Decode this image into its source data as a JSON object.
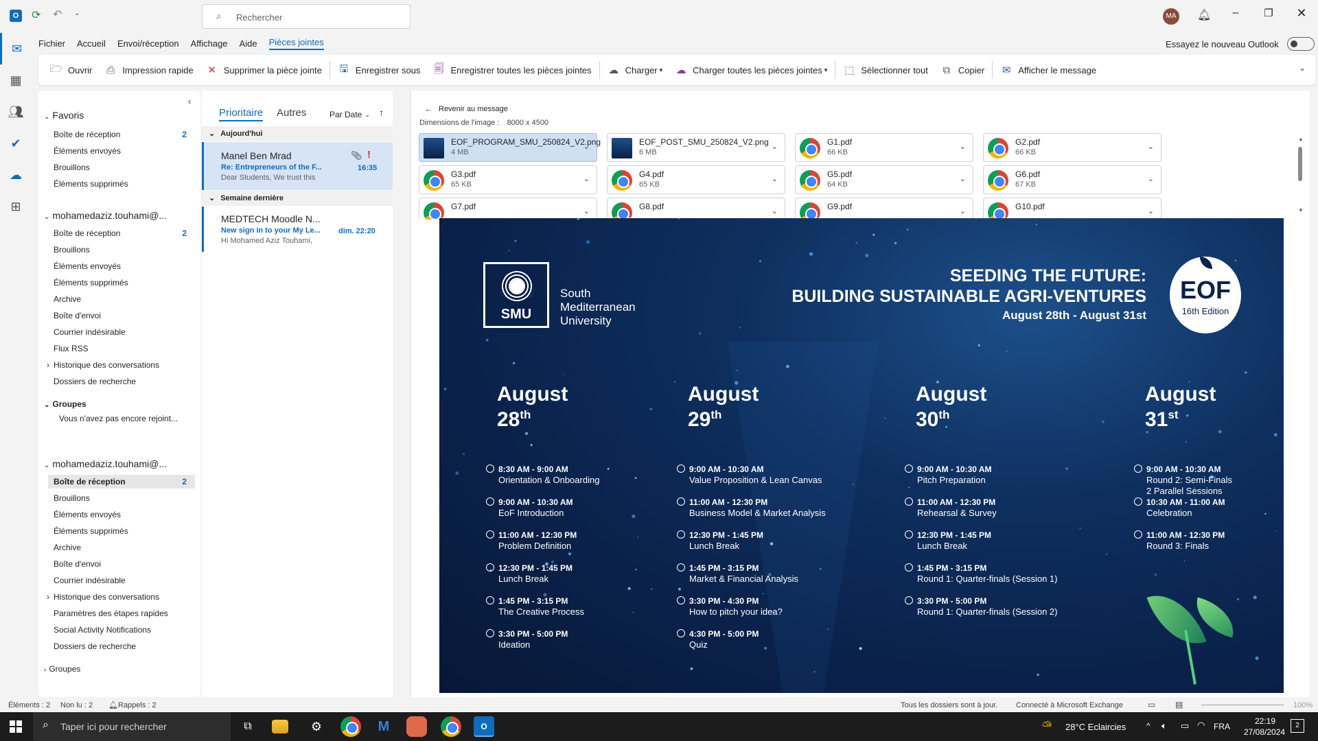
{
  "titlebar": {
    "search_placeholder": "Rechercher",
    "avatar_initials": "MA"
  },
  "menu": [
    "Fichier",
    "Accueil",
    "Envoi/réception",
    "Affichage",
    "Aide",
    "Pièces jointes"
  ],
  "try_new": "Essayez le nouveau Outlook",
  "ribbon": {
    "open": "Ouvrir",
    "quick_print": "Impression rapide",
    "remove_attachment": "Supprimer la pièce jointe",
    "save_as": "Enregistrer sous",
    "save_all": "Enregistrer toutes les pièces jointes",
    "upload": "Charger",
    "upload_all": "Charger toutes les pièces jointes",
    "select_all": "Sélectionner tout",
    "copy": "Copier",
    "show_message": "Afficher le message"
  },
  "folders": {
    "favorites_title": "Favoris",
    "favorites": [
      {
        "label": "Boîte de réception",
        "count": "2"
      },
      {
        "label": "Éléments envoyés",
        "count": ""
      },
      {
        "label": "Brouillons",
        "count": ""
      },
      {
        "label": "Éléments supprimés",
        "count": ""
      }
    ],
    "account1": "mohamedaziz.touhami@...",
    "account1_items": [
      {
        "label": "Boîte de réception",
        "count": "2"
      },
      {
        "label": "Brouillons",
        "count": ""
      },
      {
        "label": "Éléments envoyés",
        "count": ""
      },
      {
        "label": "Éléments supprimés",
        "count": ""
      },
      {
        "label": "Archive",
        "count": ""
      },
      {
        "label": "Boîte d'envoi",
        "count": ""
      },
      {
        "label": "Courrier indésirable",
        "count": ""
      },
      {
        "label": "Flux RSS",
        "count": ""
      },
      {
        "label": "Historique des conversations",
        "count": ""
      },
      {
        "label": "Dossiers de recherche",
        "count": ""
      }
    ],
    "groups_title": "Groupes",
    "groups_note": "Vous n'avez pas encore rejoint...",
    "account2": "mohamedaziz.touhami@...",
    "account2_items": [
      {
        "label": "Boîte de réception",
        "count": "2"
      },
      {
        "label": "Brouillons",
        "count": ""
      },
      {
        "label": "Éléments envoyés",
        "count": ""
      },
      {
        "label": "Éléments supprimés",
        "count": ""
      },
      {
        "label": "Archive",
        "count": ""
      },
      {
        "label": "Boîte d'envoi",
        "count": ""
      },
      {
        "label": "Courrier indésirable",
        "count": ""
      },
      {
        "label": "Historique des conversations",
        "count": ""
      },
      {
        "label": "Paramètres des étapes rapides",
        "count": ""
      },
      {
        "label": "Social Activity Notifications",
        "count": ""
      },
      {
        "label": "Dossiers de recherche",
        "count": ""
      }
    ],
    "groups2_title": "Groupes"
  },
  "maillist": {
    "tab_focused": "Prioritaire",
    "tab_other": "Autres",
    "sort": "Par Date",
    "group_today": "Aujourd'hui",
    "group_lastweek": "Semaine dernière",
    "messages": [
      {
        "sender": "Manel Ben Mrad",
        "subject": "Re: Entrepreneurs of the F...",
        "time": "16:35",
        "preview": "Dear Students,  We trust this"
      },
      {
        "sender": "MEDTECH Moodle N...",
        "subject": "New sign in to your My Le...",
        "time": "dim. 22:20",
        "preview": "Hi Mohamed Aziz Touhami,"
      }
    ]
  },
  "reading": {
    "back": "Revenir au message",
    "dimensions_label": "Dimensions de l'image :",
    "dimensions_value": "8000 x 4500",
    "attachments": [
      {
        "name": "EOF_PROGRAM_SMU_250824_V2.png",
        "size": "4 MB",
        "type": "image"
      },
      {
        "name": "EOF_POST_SMU_250824_V2.png",
        "size": "6 MB",
        "type": "image"
      },
      {
        "name": "G1.pdf",
        "size": "66 KB",
        "type": "pdf"
      },
      {
        "name": "G2.pdf",
        "size": "66 KB",
        "type": "pdf"
      },
      {
        "name": "G3.pdf",
        "size": "65 KB",
        "type": "pdf"
      },
      {
        "name": "G4.pdf",
        "size": "65 KB",
        "type": "pdf"
      },
      {
        "name": "G5.pdf",
        "size": "64 KB",
        "type": "pdf"
      },
      {
        "name": "G6.pdf",
        "size": "67 KB",
        "type": "pdf"
      },
      {
        "name": "G7.pdf",
        "size": "",
        "type": "pdf"
      },
      {
        "name": "G8.pdf",
        "size": "",
        "type": "pdf"
      },
      {
        "name": "G9.pdf",
        "size": "",
        "type": "pdf"
      },
      {
        "name": "G10.pdf",
        "size": "",
        "type": "pdf"
      }
    ]
  },
  "poster": {
    "logo_text": "SMU",
    "uni_line1": "South",
    "uni_line2": "Mediterranean",
    "uni_line3": "University",
    "title1": "SEEDING THE FUTURE:",
    "title2": "BUILDING SUSTAINABLE AGRI-VENTURES",
    "dates": "August 28th - August 31st",
    "eof": "EOF",
    "edition": "16th Edition",
    "days": [
      {
        "month": "August",
        "day": "28",
        "suffix": "th",
        "sessions": [
          {
            "time": "8:30 AM - 9:00 AM",
            "title": "Orientation & Onboarding"
          },
          {
            "time": "9:00 AM - 10:30 AM",
            "title": "EoF Introduction"
          },
          {
            "time": "11:00 AM - 12:30 PM",
            "title": "Problem Definition"
          },
          {
            "time": "12:30 PM - 1:45 PM",
            "title": "Lunch Break"
          },
          {
            "time": "1:45 PM - 3:15 PM",
            "title": "The Creative Process"
          },
          {
            "time": "3:30 PM - 5:00 PM",
            "title": "Ideation"
          }
        ]
      },
      {
        "month": "August",
        "day": "29",
        "suffix": "th",
        "sessions": [
          {
            "time": "9:00 AM - 10:30 AM",
            "title": "Value Proposition & Lean Canvas"
          },
          {
            "time": "11:00 AM - 12:30 PM",
            "title": "Business Model & Market Analysis"
          },
          {
            "time": "12:30 PM - 1:45 PM",
            "title": "Lunch Break"
          },
          {
            "time": "1:45 PM - 3:15 PM",
            "title": "Market & Financial Analysis"
          },
          {
            "time": "3:30 PM - 4:30 PM",
            "title": "How to pitch your idea?"
          },
          {
            "time": "4:30 PM - 5:00 PM",
            "title": "Quiz"
          }
        ]
      },
      {
        "month": "August",
        "day": "30",
        "suffix": "th",
        "sessions": [
          {
            "time": "9:00 AM - 10:30 AM",
            "title": "Pitch Preparation"
          },
          {
            "time": "11:00 AM - 12:30 PM",
            "title": "Rehearsal & Survey"
          },
          {
            "time": "12:30 PM - 1:45 PM",
            "title": "Lunch Break"
          },
          {
            "time": "1:45 PM - 3:15 PM",
            "title": "Round 1: Quarter-finals (Session 1)"
          },
          {
            "time": "3:30 PM - 5:00 PM",
            "title": "Round 1: Quarter-finals (Session 2)"
          }
        ]
      },
      {
        "month": "August",
        "day": "31",
        "suffix": "st",
        "sessions": [
          {
            "time": "9:00 AM - 10:30 AM",
            "title": "Round 2: Semi-Finals\n2 Parallel Sessions"
          },
          {
            "time": "10:30 AM - 11:00 AM",
            "title": "Celebration"
          },
          {
            "time": "11:00 AM - 12:30 PM",
            "title": "Round 3: Finals"
          }
        ]
      }
    ]
  },
  "status": {
    "items": "Éléments : 2",
    "unread": "Non lu : 2",
    "reminders": "Rappels : 2",
    "sync": "Tous les dossiers sont à jour.",
    "connected": "Connecté à Microsoft Exchange",
    "zoom": "100%"
  },
  "taskbar": {
    "search_placeholder": "Taper ici pour rechercher",
    "weather": "28°C  Eclaircies",
    "lang": "FRA",
    "time": "22:19",
    "date": "27/08/2024",
    "notif_count": "2"
  },
  "colors": {
    "accent": "#0f6cbd",
    "poster_bg": "#0a2149",
    "taskbar": "#1c1c1c"
  }
}
